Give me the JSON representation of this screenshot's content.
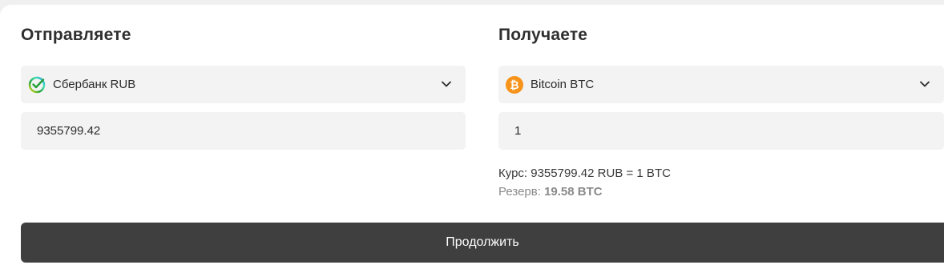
{
  "send": {
    "title": "Отправляете",
    "currency_label": "Сбербанк RUB",
    "currency_icon": "sberbank-icon",
    "amount_value": "9355799.42"
  },
  "receive": {
    "title": "Получаете",
    "currency_label": "Bitcoin BTC",
    "currency_icon": "bitcoin-icon",
    "amount_value": "1",
    "rate_text": "Курс: 9355799.42 RUB = 1 BTC",
    "reserve_label": "Резерв:",
    "reserve_value": "19.58 BTC"
  },
  "continue_label": "Продолжить",
  "colors": {
    "button_bg": "#3f3f3f",
    "field_bg": "#f3f3f3",
    "bitcoin_orange": "#f7931a",
    "sber_green": "#21a038"
  }
}
